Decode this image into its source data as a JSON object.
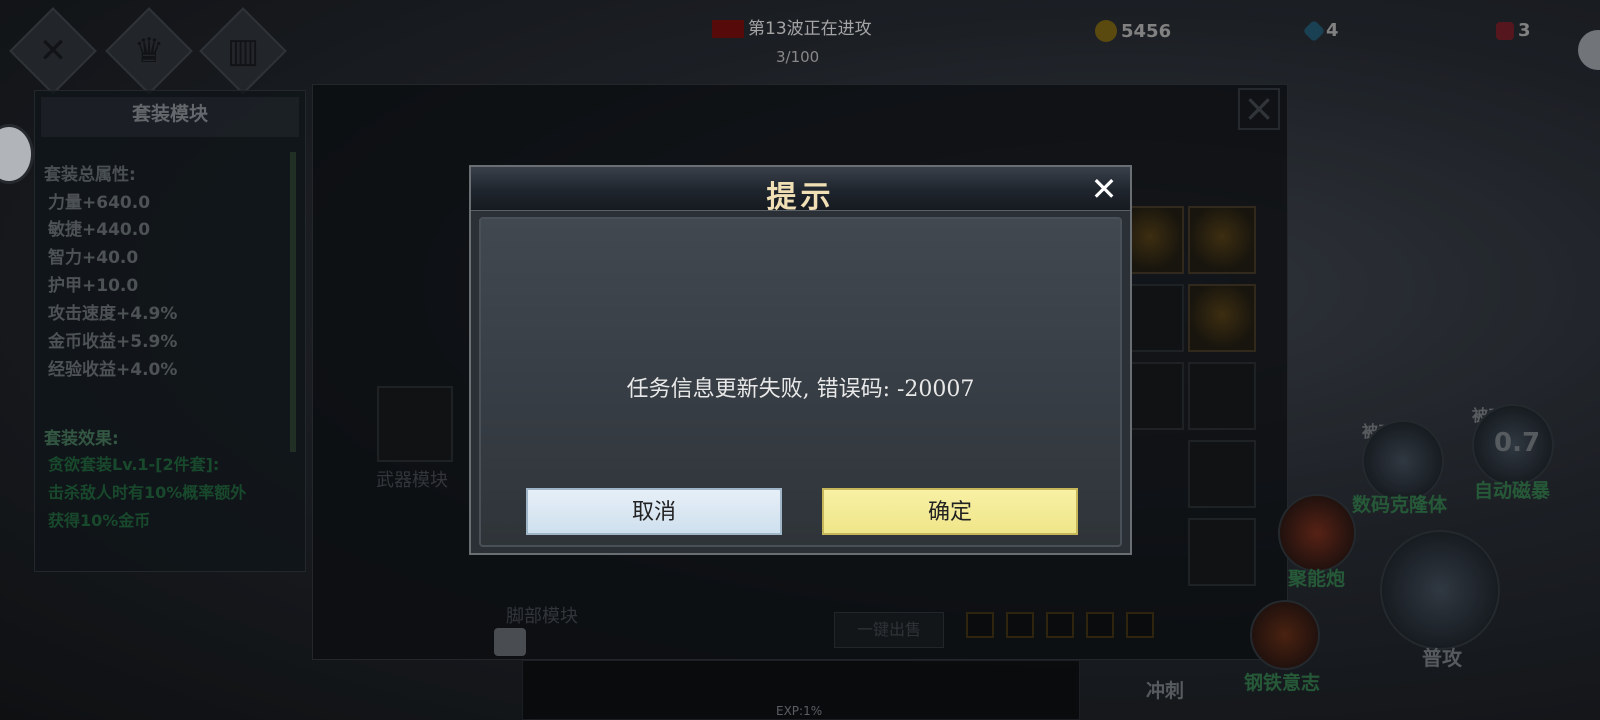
{
  "hud": {
    "wave_text": "第13波正在进攻",
    "wave_progress": "3/100",
    "gold": "5456",
    "gems": "4",
    "rubies": "3"
  },
  "set_panel": {
    "title": "套装模块",
    "stats_heading": "套装总属性:",
    "stats": [
      "力量+640.0",
      "敏捷+440.0",
      "智力+40.0",
      "护甲+10.0",
      "攻击速度+4.9%",
      "金币收益+5.9%",
      "经验收益+4.0%"
    ],
    "effect_heading": "套装效果:",
    "effect_lines": [
      "贪欲套装Lv.1-[2件套]:",
      "击杀敌人时有10%概率额外",
      "获得10%金币"
    ]
  },
  "modules": {
    "weapon_label": "武器模块",
    "foot_label": "脚部模块",
    "sell_button": "一键出售",
    "exp": "EXP:1%"
  },
  "skills": {
    "passive1": "被动",
    "passive2": "被动",
    "auto_value": "0.7",
    "clone": "数码克隆体",
    "auto_storm": "自动磁暴",
    "cannon": "聚能炮",
    "attack": "普攻",
    "dash": "冲刺",
    "iron_will": "钢铁意志"
  },
  "dialog": {
    "title": "提示",
    "message": "任务信息更新失败, 错误码: -20007",
    "cancel": "取消",
    "confirm": "确定"
  }
}
